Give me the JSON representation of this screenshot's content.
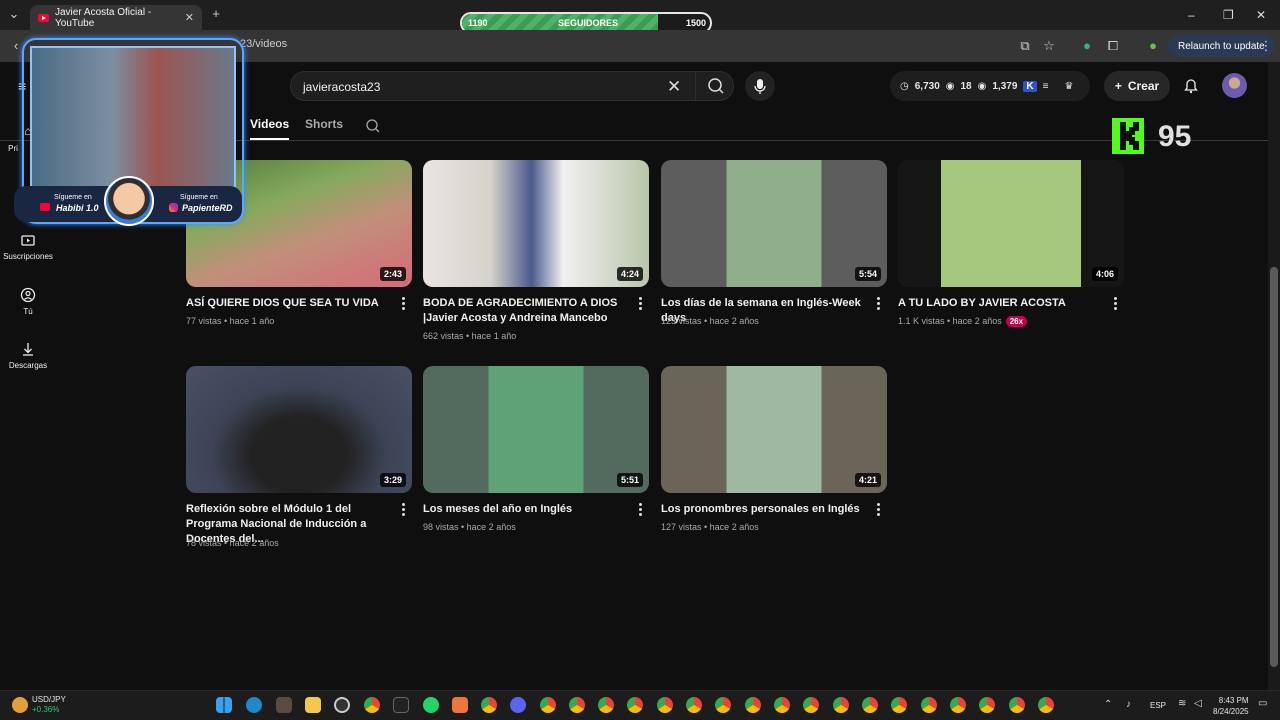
{
  "browser": {
    "tab_title": "Javier Acosta Oficial - YouTube",
    "url": "23/videos",
    "relaunch_label": "Relaunch to update"
  },
  "followers_widget": {
    "current": "1190",
    "label": "SEGUIDORES",
    "goal": "1500",
    "progress_fraction": 0.79
  },
  "youtube": {
    "search_value": "javieracosta23",
    "stats": {
      "a": "6,730",
      "b": "18",
      "c": "1,379"
    },
    "create_label": "Crear",
    "tabs": [
      {
        "label": "Videos"
      },
      {
        "label": "Shorts"
      }
    ],
    "sidebar": [
      {
        "label": "Pri"
      },
      {
        "label": "Suscripciones"
      },
      {
        "label": "Tú"
      },
      {
        "label": "Descargas"
      }
    ],
    "videos": [
      {
        "title": "ASÍ QUIERE DIOS QUE SEA TU VIDA",
        "meta": "77 vistas • hace 1 año",
        "duration": "2:43",
        "badge": ""
      },
      {
        "title": "BODA DE AGRADECIMIENTO A DIOS |Javier Acosta y Andreina Mancebo",
        "meta": "662 vistas • hace 1 año",
        "duration": "4:24",
        "badge": ""
      },
      {
        "title": "Los días de la semana en Inglés-Week days",
        "meta": "123 vistas • hace 2 años",
        "duration": "5:54",
        "badge": ""
      },
      {
        "title": "A TU LADO BY JAVIER ACOSTA",
        "meta": "1.1 K vistas • hace 2 años",
        "duration": "4:06",
        "badge": "26x"
      },
      {
        "title": "Reflexión sobre el Módulo 1 del Programa Nacional de Inducción a Docentes del...",
        "meta": "78 vistas • hace 2 años",
        "duration": "3:29",
        "badge": ""
      },
      {
        "title": "Los meses del año en Inglés",
        "meta": "98 vistas • hace 2 años",
        "duration": "5:51",
        "badge": ""
      },
      {
        "title": "Los pronombres personales en Inglés",
        "meta": "127 vistas • hace 2 años",
        "duration": "4:21",
        "badge": ""
      }
    ]
  },
  "kick_widget": {
    "count": "95"
  },
  "overlay": {
    "left_caption": "Sígueme en",
    "left_handle": "Habibi 1.0",
    "right_caption": "Sígueme en",
    "right_handle": "PapienteRD"
  },
  "taskbar": {
    "ticker_symbol": "USD/JPY",
    "ticker_change": "+0.36%",
    "lang": "ESP",
    "time": "8:43 PM",
    "date": "8/24/2025"
  }
}
